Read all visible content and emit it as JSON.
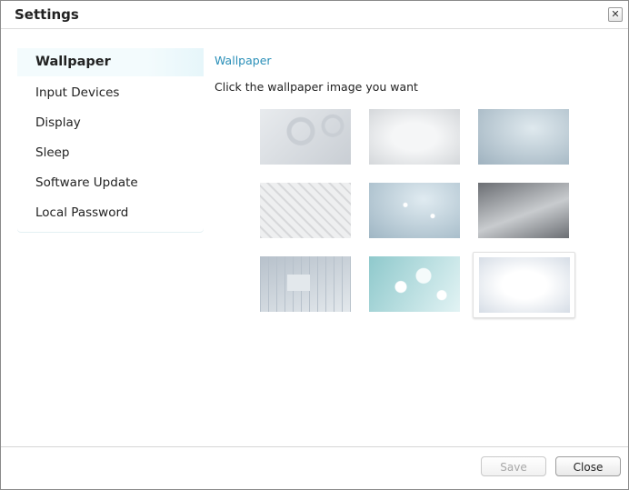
{
  "dialog": {
    "title": "Settings",
    "close_icon": "close-icon"
  },
  "sidebar": {
    "items": [
      {
        "label": "Wallpaper",
        "selected": true
      },
      {
        "label": "Input Devices"
      },
      {
        "label": "Display"
      },
      {
        "label": "Sleep"
      },
      {
        "label": "Software Update"
      },
      {
        "label": "Local Password"
      }
    ]
  },
  "content": {
    "section_title": "Wallpaper",
    "instructions": "Click the wallpaper image you want",
    "wallpapers": [
      {
        "name": "gears",
        "colors": [
          "#c9ced4",
          "#e8ebee"
        ]
      },
      {
        "name": "soft-gray",
        "colors": [
          "#d4d7da",
          "#f5f6f7"
        ]
      },
      {
        "name": "blue-glow",
        "colors": [
          "#9fb2bf",
          "#dfe9ee"
        ]
      },
      {
        "name": "diamond-plate",
        "colors": [
          "#d7d8da",
          "#eeeff0"
        ]
      },
      {
        "name": "water-drops",
        "colors": [
          "#9fb6c4",
          "#e0ebf1"
        ]
      },
      {
        "name": "dark-gradient",
        "colors": [
          "#6b6e73",
          "#c8cbce"
        ]
      },
      {
        "name": "circuit-board",
        "colors": [
          "#b7c1cb",
          "#e3e8ec"
        ]
      },
      {
        "name": "bokeh",
        "colors": [
          "#8fc9cc",
          "#e2f3f4"
        ]
      },
      {
        "name": "white-glow",
        "colors": [
          "#d6dde6",
          "#ffffff"
        ],
        "selected": true
      }
    ]
  },
  "footer": {
    "save_label": "Save",
    "close_label": "Close",
    "save_enabled": false
  }
}
